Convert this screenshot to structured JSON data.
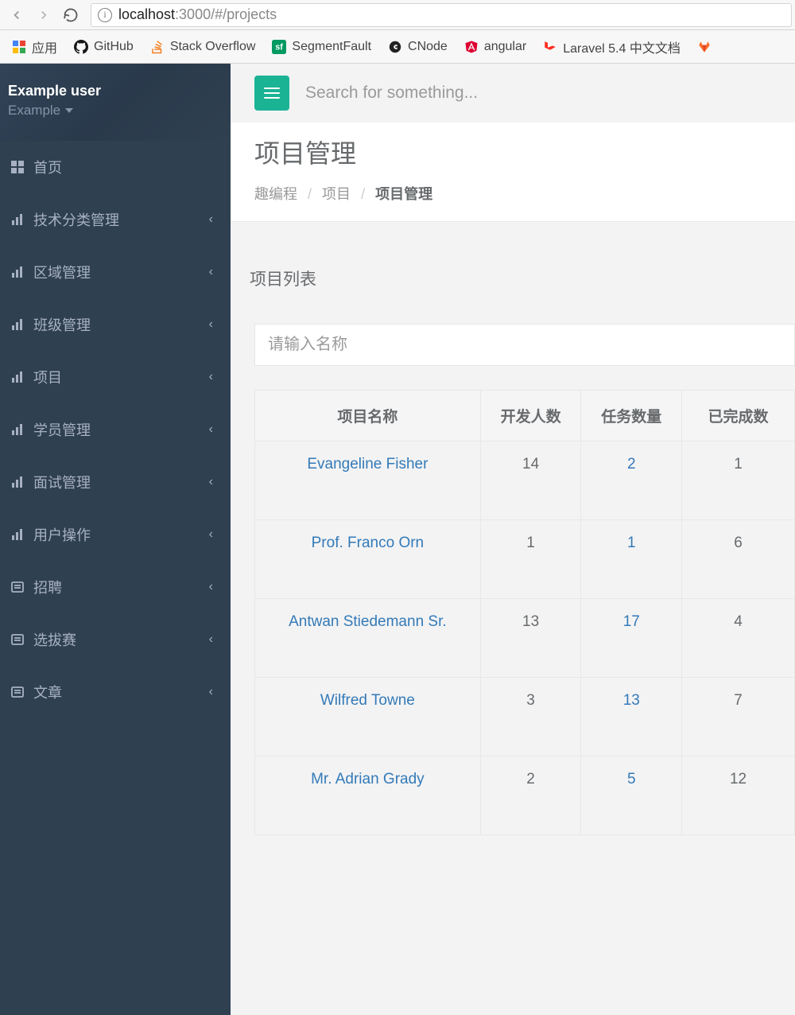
{
  "browser": {
    "url_host": "localhost",
    "url_port_path": ":3000/#/projects",
    "bookmarks": [
      {
        "label": "应用",
        "icon": "apps"
      },
      {
        "label": "GitHub",
        "icon": "github"
      },
      {
        "label": "Stack Overflow",
        "icon": "stackoverflow"
      },
      {
        "label": "SegmentFault",
        "icon": "segmentfault"
      },
      {
        "label": "CNode",
        "icon": "cnode"
      },
      {
        "label": "angular",
        "icon": "angular"
      },
      {
        "label": "Laravel 5.4 中文文档",
        "icon": "laravel"
      },
      {
        "label": "",
        "icon": "gitlab"
      }
    ]
  },
  "sidebar": {
    "user_name": "Example user",
    "user_role": "Example",
    "items": [
      {
        "label": "首页",
        "icon": "grid",
        "expandable": false
      },
      {
        "label": "技术分类管理",
        "icon": "chart",
        "expandable": true
      },
      {
        "label": "区域管理",
        "icon": "chart",
        "expandable": true
      },
      {
        "label": "班级管理",
        "icon": "chart",
        "expandable": true
      },
      {
        "label": "项目",
        "icon": "chart",
        "expandable": true
      },
      {
        "label": "学员管理",
        "icon": "chart",
        "expandable": true
      },
      {
        "label": "面试管理",
        "icon": "chart",
        "expandable": true
      },
      {
        "label": "用户操作",
        "icon": "chart",
        "expandable": true
      },
      {
        "label": "招聘",
        "icon": "doc",
        "expandable": true
      },
      {
        "label": "选拔赛",
        "icon": "doc",
        "expandable": true
      },
      {
        "label": "文章",
        "icon": "doc",
        "expandable": true
      }
    ]
  },
  "topbar": {
    "search_placeholder": "Search for something..."
  },
  "header": {
    "title": "项目管理",
    "crumbs": [
      "趣编程",
      "项目",
      "项目管理"
    ]
  },
  "panel": {
    "title": "项目列表",
    "search_placeholder": "请输入名称"
  },
  "table": {
    "columns": [
      "项目名称",
      "开发人数",
      "任务数量",
      "已完成数"
    ],
    "rows": [
      {
        "name": "Evangeline Fisher",
        "dev": "14",
        "task": "2",
        "done": "1"
      },
      {
        "name": "Prof. Franco Orn",
        "dev": "1",
        "task": "1",
        "done": "6"
      },
      {
        "name": "Antwan Stiedemann Sr.",
        "dev": "13",
        "task": "17",
        "done": "4"
      },
      {
        "name": "Wilfred Towne",
        "dev": "3",
        "task": "13",
        "done": "7"
      },
      {
        "name": "Mr. Adrian Grady",
        "dev": "2",
        "task": "5",
        "done": "12"
      }
    ]
  }
}
